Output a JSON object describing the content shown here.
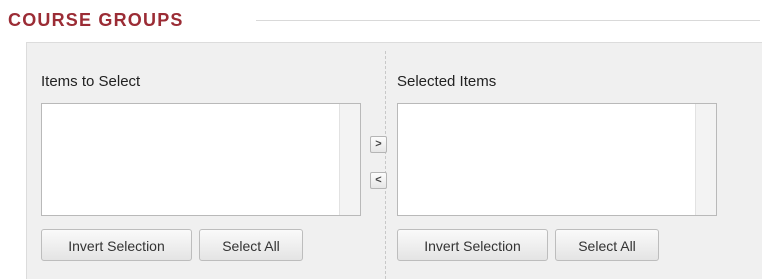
{
  "section": {
    "title": "COURSE GROUPS"
  },
  "items_to_select": {
    "label": "Items to Select",
    "invert_label": "Invert Selection",
    "select_all_label": "Select All"
  },
  "selected_items": {
    "label": "Selected Items",
    "invert_label": "Invert Selection",
    "select_all_label": "Select All"
  },
  "transfer": {
    "add_glyph": ">",
    "remove_glyph": "<"
  },
  "colors": {
    "title": "#9b2c35",
    "panel_bg": "#f0f0f0"
  },
  "icons": [
    "chevron-right-icon",
    "chevron-left-icon"
  ]
}
